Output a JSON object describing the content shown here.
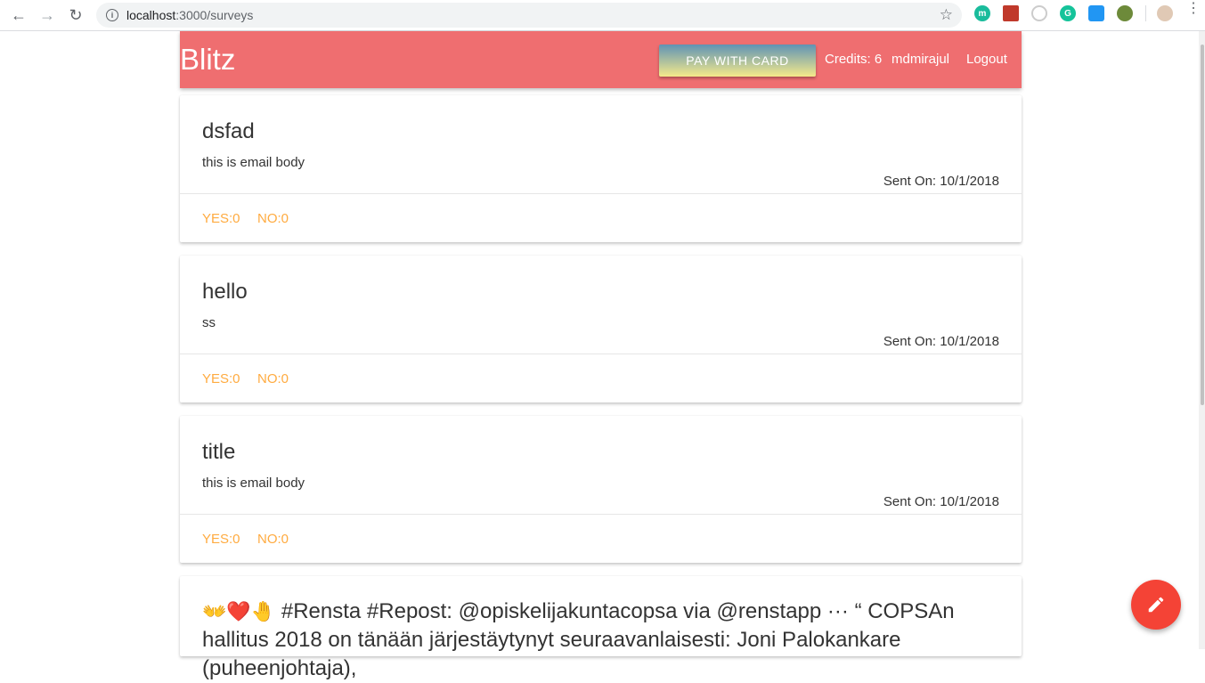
{
  "browser": {
    "url_host": "localhost",
    "url_path": ":3000/surveys"
  },
  "app": {
    "logo": "Blitz",
    "pay_label": "PAY WITH CARD",
    "credits": "Credits: 6",
    "username": "mdmirajul",
    "logout": "Logout"
  },
  "surveys": [
    {
      "title": "dsfad",
      "body": "this is email body",
      "sent": "Sent On: 10/1/2018",
      "yes": "YES:0",
      "no": "NO:0"
    },
    {
      "title": "hello",
      "body": "ss",
      "sent": "Sent On: 10/1/2018",
      "yes": "YES:0",
      "no": "NO:0"
    },
    {
      "title": "title",
      "body": "this is email body",
      "sent": "Sent On: 10/1/2018",
      "yes": "YES:0",
      "no": "NO:0"
    }
  ],
  "last_card": {
    "emoji": "👐❤️🤚",
    "text": " #Rensta #Repost: @opiskelijakuntacopsa via @renstapp ··· “ COPSAn hallitus 2018 on tänään järjestäytynyt seuraavanlaisesti: Joni Palokankare (puheenjohtaja),"
  },
  "colors": {
    "navbar": "#ef6e70",
    "action": "#ffab40",
    "fab": "#f44336"
  },
  "icons": {
    "fab": "pencil-icon"
  }
}
